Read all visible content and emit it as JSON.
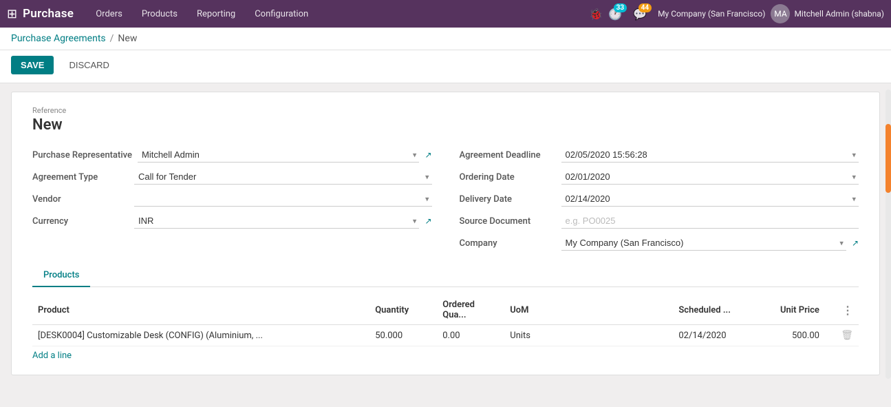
{
  "app": {
    "brand": "Purchase",
    "nav_items": [
      "Orders",
      "Products",
      "Reporting",
      "Configuration"
    ],
    "badge_activity": "33",
    "badge_message": "44",
    "company": "My Company (San Francisco)",
    "user": "Mitchell Admin (shabna)"
  },
  "breadcrumb": {
    "parent_label": "Purchase Agreements",
    "separator": "/",
    "current_label": "New"
  },
  "actions": {
    "save_label": "SAVE",
    "discard_label": "DISCARD"
  },
  "form": {
    "reference_label": "Reference",
    "reference_value": "New",
    "fields": {
      "purchase_rep_label": "Purchase Representative",
      "purchase_rep_value": "Mitchell Admin",
      "agreement_type_label": "Agreement Type",
      "agreement_type_value": "Call for Tender",
      "vendor_label": "Vendor",
      "vendor_value": "",
      "currency_label": "Currency",
      "currency_value": "INR",
      "agreement_deadline_label": "Agreement Deadline",
      "agreement_deadline_value": "02/05/2020 15:56:28",
      "ordering_date_label": "Ordering Date",
      "ordering_date_value": "02/01/2020",
      "delivery_date_label": "Delivery Date",
      "delivery_date_value": "02/14/2020",
      "source_document_label": "Source Document",
      "source_document_placeholder": "e.g. PO0025",
      "company_label": "Company",
      "company_value": "My Company (San Francisco)"
    }
  },
  "tabs": [
    {
      "label": "Products",
      "active": true
    }
  ],
  "table": {
    "columns": [
      "Product",
      "Quantity",
      "Ordered Qua...",
      "UoM",
      "Scheduled ...",
      "Unit Price",
      ""
    ],
    "rows": [
      {
        "product": "[DESK0004] Customizable Desk (CONFIG) (Aluminium, ...",
        "quantity": "50.000",
        "ordered_qty": "0.00",
        "uom": "Units",
        "scheduled": "02/14/2020",
        "unit_price": "500.00"
      }
    ],
    "add_line_label": "Add a line"
  }
}
